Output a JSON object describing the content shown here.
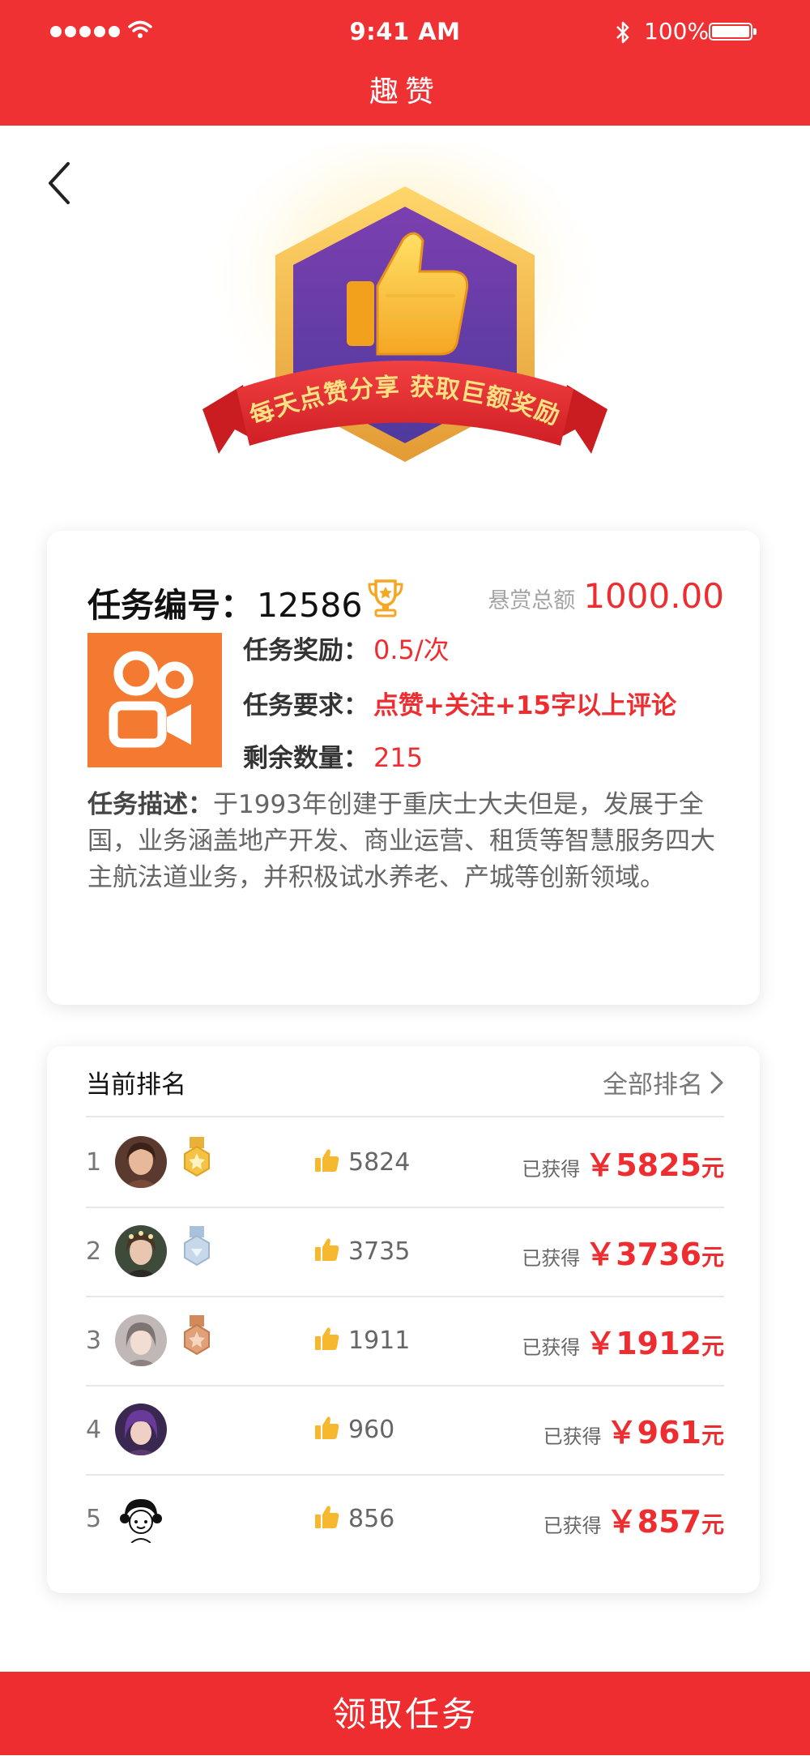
{
  "status_bar": {
    "time": "9:41 AM",
    "battery": "100%"
  },
  "header": {
    "title": "趣赞"
  },
  "banner": {
    "text": "每天点赞分享 获取巨额奖励"
  },
  "task": {
    "number_label": "任务编号：",
    "number": "12586",
    "total_label": "悬赏总额",
    "total_value": "1000.00",
    "reward_label": "任务奖励：",
    "reward_value": "0.5/次",
    "requirement_label": "任务要求：",
    "requirement_value": "点赞+关注+15字以上评论",
    "remaining_label": "剩余数量：",
    "remaining_value": "215",
    "description_label": "任务描述：",
    "description": "于1993年创建于重庆士大夫但是，发展于全国，业务涵盖地产开发、商业运营、租赁等智慧服务四大主航法道业务，并积极试水养老、产城等创新领域。"
  },
  "ranking": {
    "title": "当前排名",
    "all_label": "全部排名",
    "rows": [
      {
        "rank": "1",
        "likes": "5824",
        "earned_label": "已获得",
        "currency": "￥",
        "amount": "5825",
        "unit": "元",
        "medal": "gold-medal"
      },
      {
        "rank": "2",
        "likes": "3735",
        "earned_label": "已获得",
        "currency": "￥",
        "amount": "3736",
        "unit": "元",
        "medal": "silver-medal"
      },
      {
        "rank": "3",
        "likes": "1911",
        "earned_label": "已获得",
        "currency": "￥",
        "amount": "1912",
        "unit": "元",
        "medal": "bronze-medal"
      },
      {
        "rank": "4",
        "likes": "960",
        "earned_label": "已获得",
        "currency": "￥",
        "amount": "961",
        "unit": "元",
        "medal": ""
      },
      {
        "rank": "5",
        "likes": "856",
        "earned_label": "已获得",
        "currency": "￥",
        "amount": "857",
        "unit": "元",
        "medal": ""
      }
    ]
  },
  "actions": {
    "claim_label": "领取任务"
  },
  "colors": {
    "brand_red": "#f03134",
    "price_red": "#ee2d31",
    "kuaishou_orange": "#f47a31",
    "gold": "#f5b82e"
  }
}
